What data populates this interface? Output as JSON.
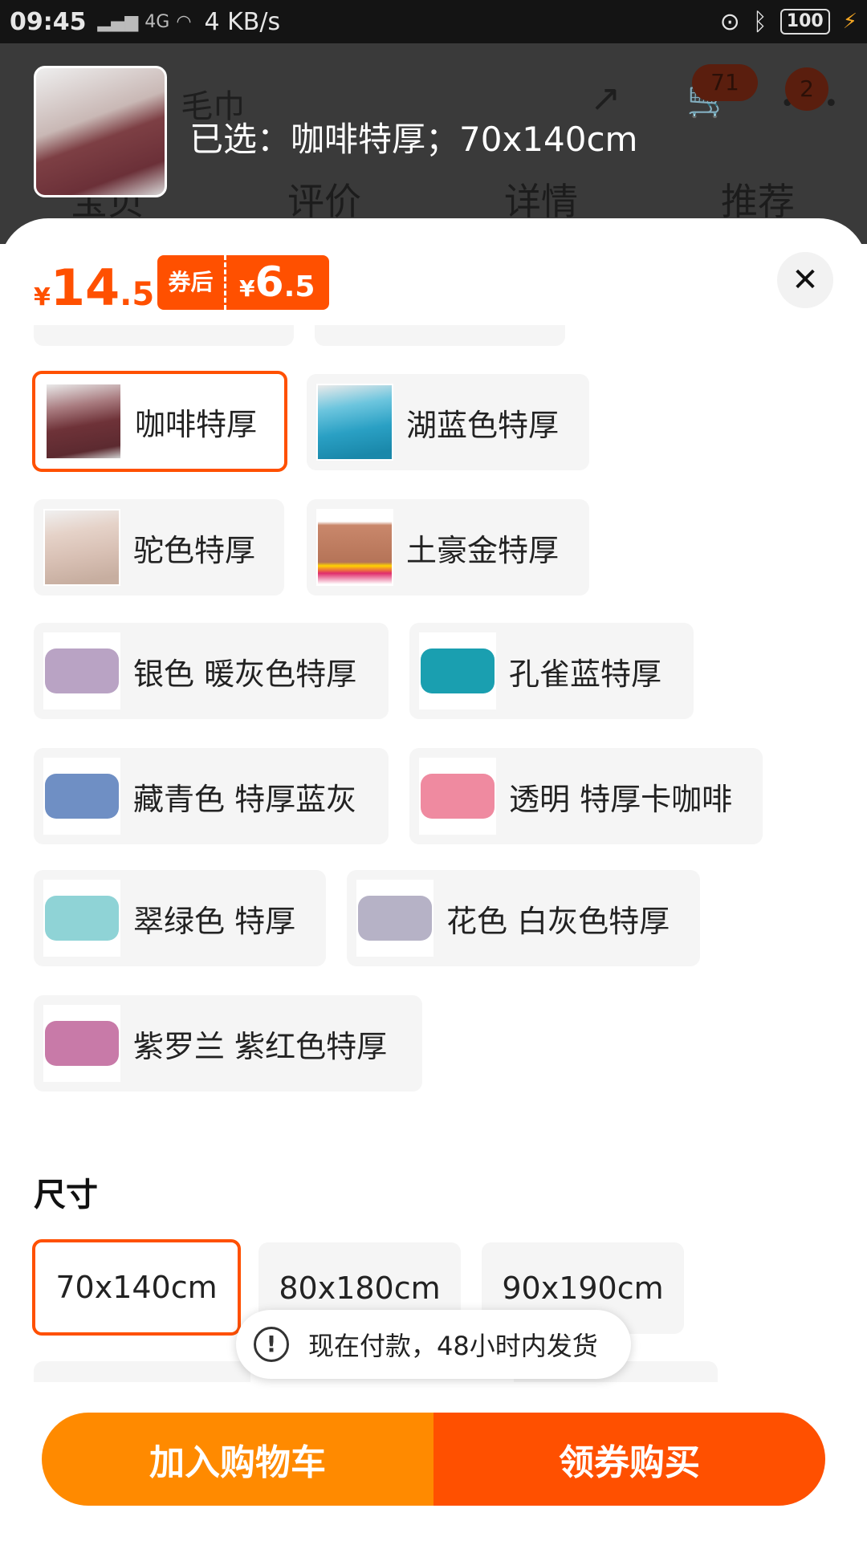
{
  "status_bar": {
    "time": "09:45",
    "network": "4G",
    "speed": "4 KB/s",
    "battery": "100"
  },
  "header": {
    "search_text": "毛巾",
    "cart_badge": "71",
    "message_badge": "2",
    "tabs": [
      "宝贝",
      "评价",
      "详情",
      "推荐"
    ]
  },
  "selection": {
    "summary": "已选：咖啡特厚；70x140cm"
  },
  "price": {
    "currency": "¥",
    "integer": "14",
    "decimal": ".5",
    "coupon_tag": "券后",
    "coupon_integer": "6",
    "coupon_decimal": ".5"
  },
  "color_options": [
    {
      "label": "咖啡特厚",
      "color": "#6e3238",
      "selected": true
    },
    {
      "label": "湖蓝色特厚",
      "color": "#2aa0c4",
      "selected": false
    },
    {
      "label": "驼色特厚",
      "color": "#d8c0b4",
      "selected": false
    },
    {
      "label": "土豪金特厚",
      "color": "#c9876b",
      "selected": false
    },
    {
      "label": "银色 暖灰色特厚",
      "color": "#b9a3c4",
      "selected": false
    },
    {
      "label": "孔雀蓝特厚",
      "color": "#1a9fb0",
      "selected": false
    },
    {
      "label": "藏青色 特厚蓝灰",
      "color": "#6f8fc4",
      "selected": false
    },
    {
      "label": "透明 特厚卡咖啡",
      "color": "#ef8aa0",
      "selected": false
    },
    {
      "label": "翠绿色 特厚",
      "color": "#8fd3d6",
      "selected": false
    },
    {
      "label": "花色 白灰色特厚",
      "color": "#b6b2c6",
      "selected": false
    },
    {
      "label": "紫罗兰 紫红色特厚",
      "color": "#c87aa8",
      "selected": false
    }
  ],
  "size": {
    "title": "尺寸",
    "options": [
      "70x140cm",
      "80x180cm",
      "90x190cm"
    ],
    "selected": "70x140cm"
  },
  "toast": {
    "message": "现在付款，48小时内发货"
  },
  "actions": {
    "add_to_cart": "加入购物车",
    "buy_with_coupon": "领券购买"
  },
  "colors": {
    "accent": "#ff5000",
    "cart_button": "#ff8a00",
    "option_bg": "#f5f5f5"
  }
}
